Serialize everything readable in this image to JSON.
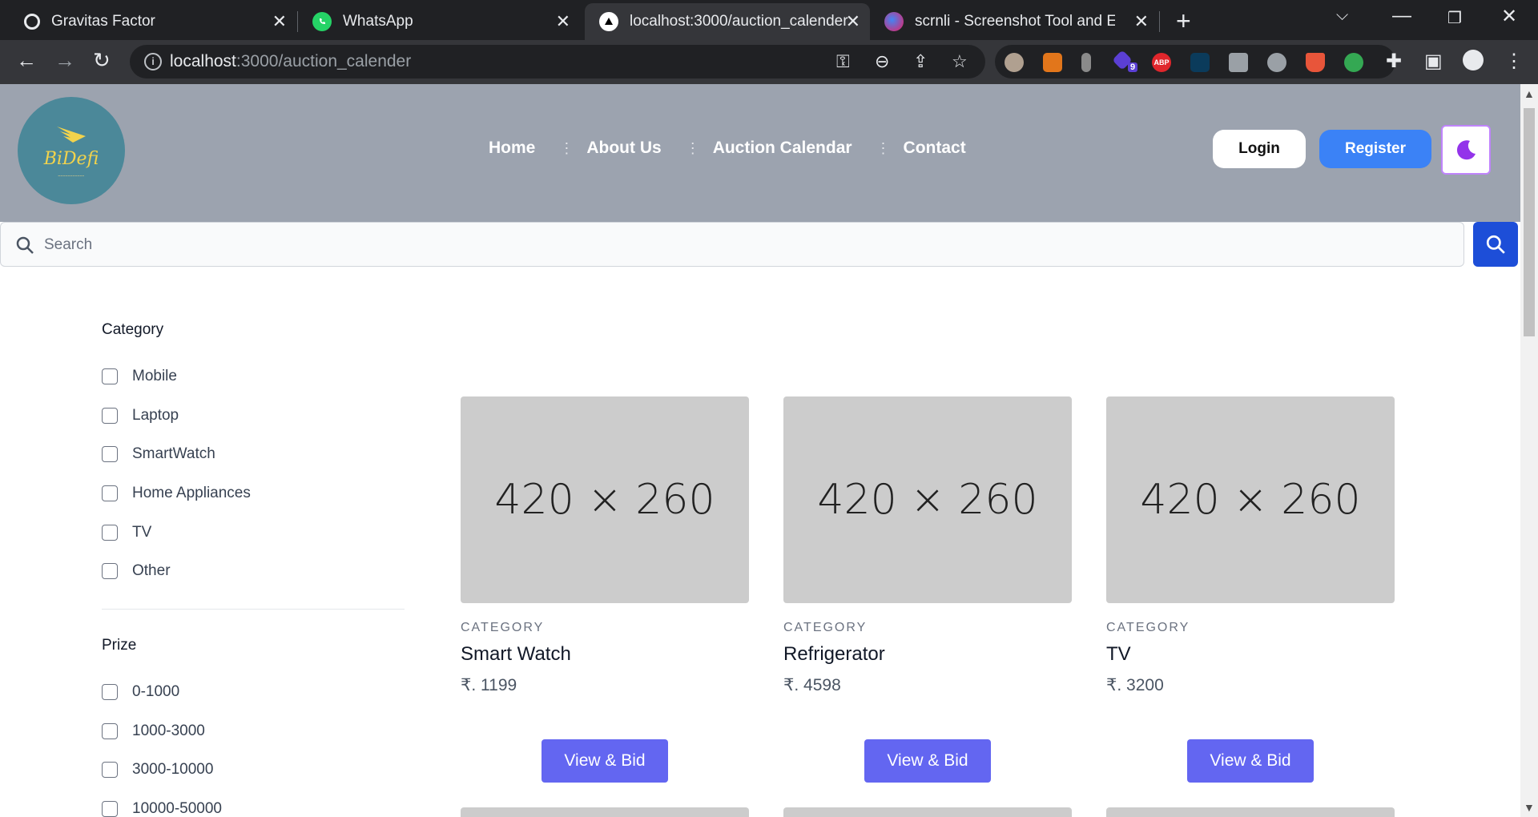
{
  "browser": {
    "tabs": [
      {
        "title": "Gravitas Factor",
        "active": false
      },
      {
        "title": "WhatsApp",
        "active": false
      },
      {
        "title": "localhost:3000/auction_calender",
        "active": true
      },
      {
        "title": "scrnli - Screenshot Tool and Editor",
        "active": false
      }
    ],
    "url_host": "localhost",
    "url_rest": ":3000/auction_calender",
    "ext_badge": "9",
    "ext_abp": "ABP"
  },
  "site": {
    "logo_text": "BiDefi",
    "nav": [
      "Home",
      "About Us",
      "Auction Calendar",
      "Contact"
    ],
    "login_label": "Login",
    "register_label": "Register",
    "search_placeholder": "Search"
  },
  "filters": {
    "category_title": "Category",
    "categories": [
      "Mobile",
      "Laptop",
      "SmartWatch",
      "Home Appliances",
      "TV",
      "Other"
    ],
    "prize_title": "Prize",
    "prizes": [
      "0-1000",
      "1000-3000",
      "3000-10000",
      "10000-50000"
    ]
  },
  "products": [
    {
      "image_text": "420 × 260",
      "category": "CATEGORY",
      "name": "Smart Watch",
      "price": "₹. 1199",
      "button": "View & Bid"
    },
    {
      "image_text": "420 × 260",
      "category": "CATEGORY",
      "name": "Refrigerator",
      "price": "₹. 4598",
      "button": "View & Bid"
    },
    {
      "image_text": "420 × 260",
      "category": "CATEGORY",
      "name": "TV",
      "price": "₹. 3200",
      "button": "View & Bid"
    }
  ],
  "colors": {
    "header": "#9ca3af",
    "register": "#3b82f6",
    "search_button": "#1d4ed8",
    "bid_button": "#6366f1",
    "theme_moon": "#9333ea"
  }
}
